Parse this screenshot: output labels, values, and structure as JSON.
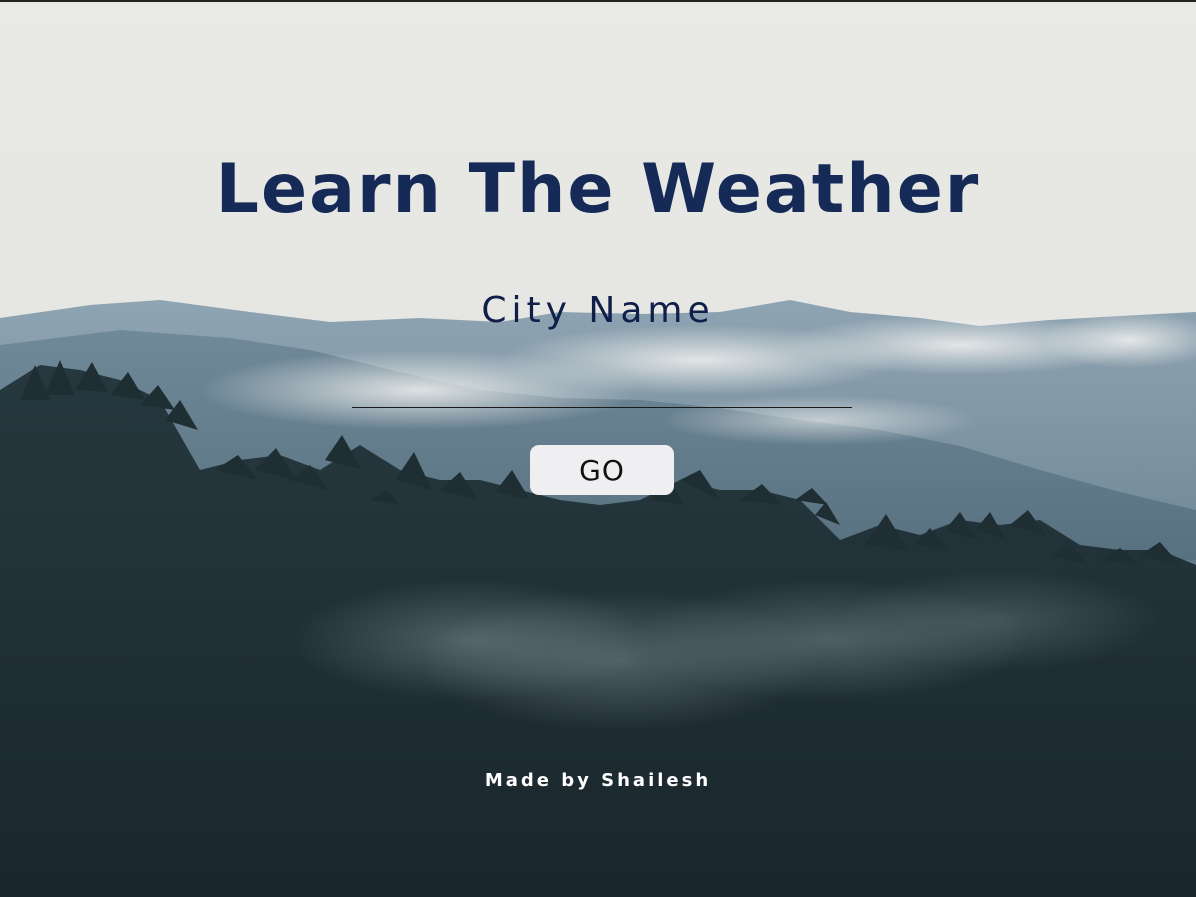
{
  "page": {
    "title": "Learn The Weather",
    "city_label": "City Name",
    "city_input": {
      "value": "",
      "placeholder": ""
    },
    "go_button_label": "GO",
    "footer": "Made by Shailesh"
  },
  "colors": {
    "title": "#152a56",
    "label": "#0f1f4a",
    "button_bg": "#efeff1",
    "footer_text": "#ffffff",
    "sky": "#e6e6e2",
    "forest": "#1c2a30"
  }
}
